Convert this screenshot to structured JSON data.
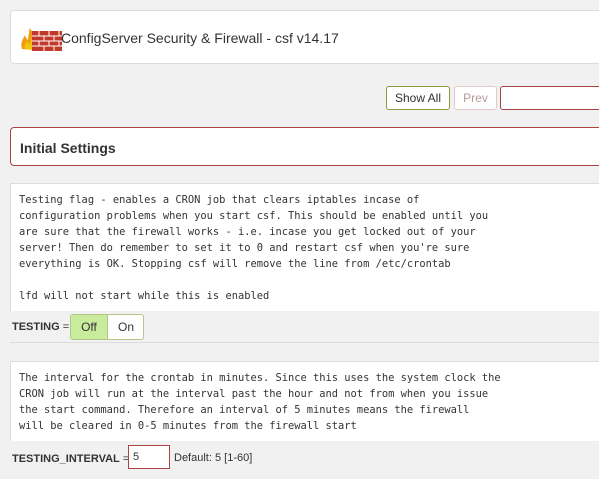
{
  "header": {
    "title": "ConfigServer Security & Firewall - csf v14.17"
  },
  "nav": {
    "show_all": "Show All",
    "prev": "Prev",
    "search_value": ""
  },
  "section": {
    "title": "Initial Settings"
  },
  "settings": [
    {
      "description": "Testing flag - enables a CRON job that clears iptables incase of\nconfiguration problems when you start csf. This should be enabled until you\nare sure that the firewall works - i.e. incase you get locked out of your\nserver! Then do remember to set it to 0 and restart csf when you're sure\neverything is OK. Stopping csf will remove the line from /etc/crontab\n\nlfd will not start while this is enabled",
      "name": "TESTING",
      "equals": " =",
      "off_label": "Off",
      "on_label": "On",
      "selected": "Off"
    },
    {
      "description": "The interval for the crontab in minutes. Since this uses the system clock the\nCRON job will run at the interval past the hour and not from when you issue\nthe start command. Therefore an interval of 5 minutes means the firewall\nwill be cleared in 0-5 minutes from the firewall start",
      "name": "TESTING_INTERVAL",
      "equals": " =",
      "value": "5",
      "default_text": "Default: 5 [1-60]"
    }
  ],
  "colors": {
    "accent_red": "#a94442",
    "toggle_active": "#c9eb9c",
    "brand_firewall": "#c0392b"
  },
  "icons": {
    "logo": "firewall-logo-icon"
  }
}
